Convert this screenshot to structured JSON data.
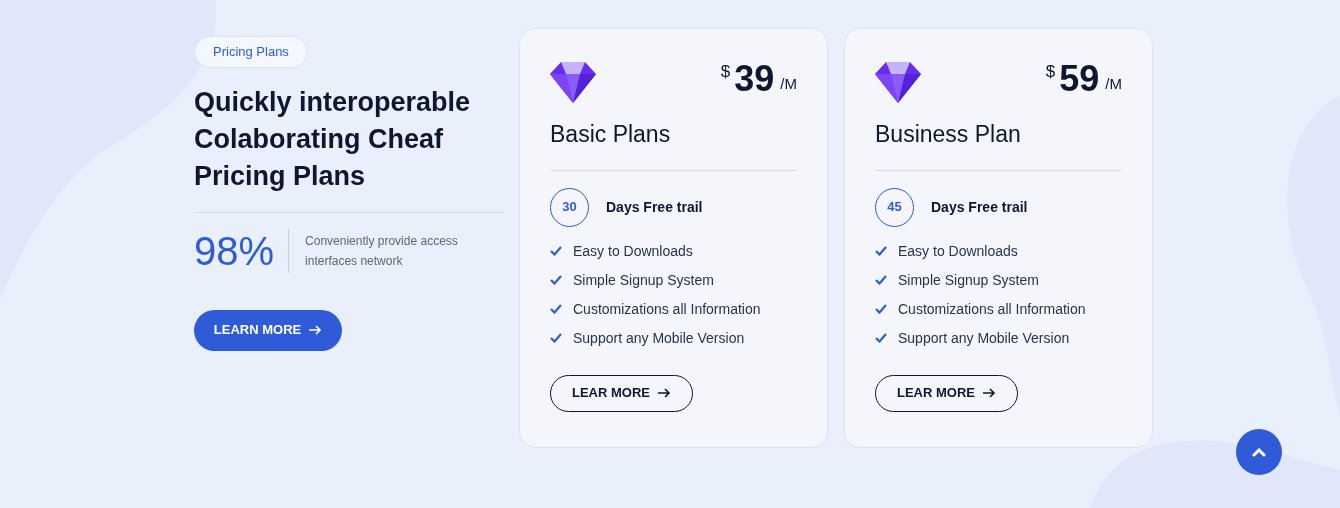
{
  "intro": {
    "badge": "Pricing Plans",
    "heading": "Quickly interoperable Colaborating Cheaf Pricing Plans",
    "stat": "98%",
    "stat_text": "Conveniently provide access interfaces network",
    "button": "LEARN MORE"
  },
  "plans": [
    {
      "currency": "$",
      "amount": "39",
      "period": "/M",
      "title": "Basic Plans",
      "trial_days": "30",
      "trial_label": "Days Free trail",
      "features": [
        "Easy to Downloads",
        "Simple Signup System",
        "Customizations all Information",
        "Support any Mobile Version"
      ],
      "button": "LEAR MORE"
    },
    {
      "currency": "$",
      "amount": "59",
      "period": "/M",
      "title": "Business Plan",
      "trial_days": "45",
      "trial_label": "Days Free trail",
      "features": [
        "Easy to Downloads",
        "Simple Signup System",
        "Customizations all Information",
        "Support any Mobile Version"
      ],
      "button": "LEAR MORE"
    }
  ]
}
